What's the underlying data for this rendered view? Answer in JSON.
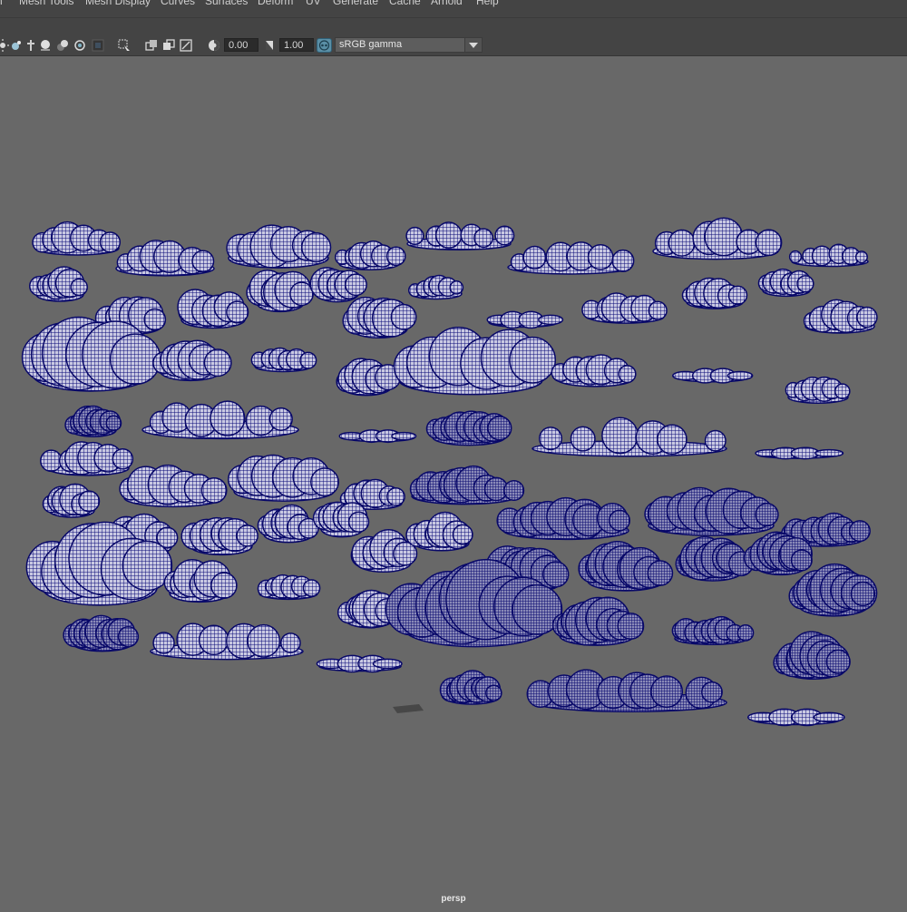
{
  "menubar": {
    "items": [
      {
        "label": "h"
      },
      {
        "label": "Mesh Tools"
      },
      {
        "label": "Mesh Display"
      },
      {
        "label": "Curves"
      },
      {
        "label": "Surfaces"
      },
      {
        "label": "Deform"
      },
      {
        "label": "UV"
      },
      {
        "label": "Generate"
      },
      {
        "label": "Cache"
      },
      {
        "label": "Arnold"
      },
      {
        "label": "Help"
      }
    ]
  },
  "toolbar": {
    "exposure_value": "0.00",
    "gamma_value": "1.00",
    "color_space": "sRGB gamma",
    "icons": [
      "light-icon",
      "shade-icon",
      "ao-icon",
      "motion-blur-icon",
      "aa-icon",
      "depth-icon",
      "isolate-select-icon",
      "xray-icon",
      "xray-active-icon",
      "xray-joints-icon",
      "exposure-icon",
      "gamma-icon",
      "color-management-icon"
    ]
  },
  "viewport": {
    "camera": "persp",
    "wireframe_color": "#0c0c7a",
    "mesh_fill_color": "#cfcfe6",
    "background_color": "#686868",
    "object_count": 60
  },
  "colors": {
    "menubar_bg": "#444444",
    "menu_text": "#cfcfcf",
    "field_bg": "#2b2b2b",
    "accent_badge": "#5a8fa6"
  }
}
